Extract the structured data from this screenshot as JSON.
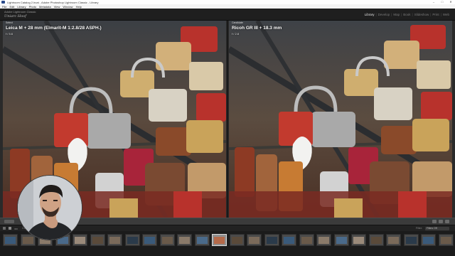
{
  "window": {
    "title": "Lightroom Catalog 2.lrcat - Adobe Photoshop Lightroom Classic - Library",
    "controls": [
      "–",
      "□",
      "✕"
    ]
  },
  "menu": [
    "File",
    "Edit",
    "Library",
    "Photo",
    "Metadata",
    "View",
    "Window",
    "Help"
  ],
  "identity_plate": {
    "line1": "Adobe Lightroom Classic",
    "line2": "Uniarc Hoof"
  },
  "modules": [
    {
      "label": "Library",
      "active": true
    },
    {
      "label": "Develop",
      "active": false
    },
    {
      "label": "Map",
      "active": false
    },
    {
      "label": "Book",
      "active": false
    },
    {
      "label": "Slideshow",
      "active": false
    },
    {
      "label": "Print",
      "active": false
    },
    {
      "label": "Web",
      "active": false
    }
  ],
  "compare": {
    "left": {
      "tag": "Select",
      "lens": "Leica M + 28 mm (Elmarit-M 1:2.8/28 ASPH.)",
      "aperture": "f / 5.6"
    },
    "right": {
      "tag": "Candidate",
      "lens": "Ricoh GR III + 18.3 mm",
      "aperture": "f / 2.8"
    }
  },
  "filmstrip": {
    "source": "Collection: LENSVERGLEICH",
    "filter_label": "Filter:",
    "filter_value": "Filters Off",
    "selected_index": 12,
    "thumbnails": 26
  },
  "colors": {
    "accent": "#ececec",
    "lock_red": "#b8322c",
    "lock_brass": "#c9a35a",
    "lock_rust": "#8a4a2a"
  }
}
